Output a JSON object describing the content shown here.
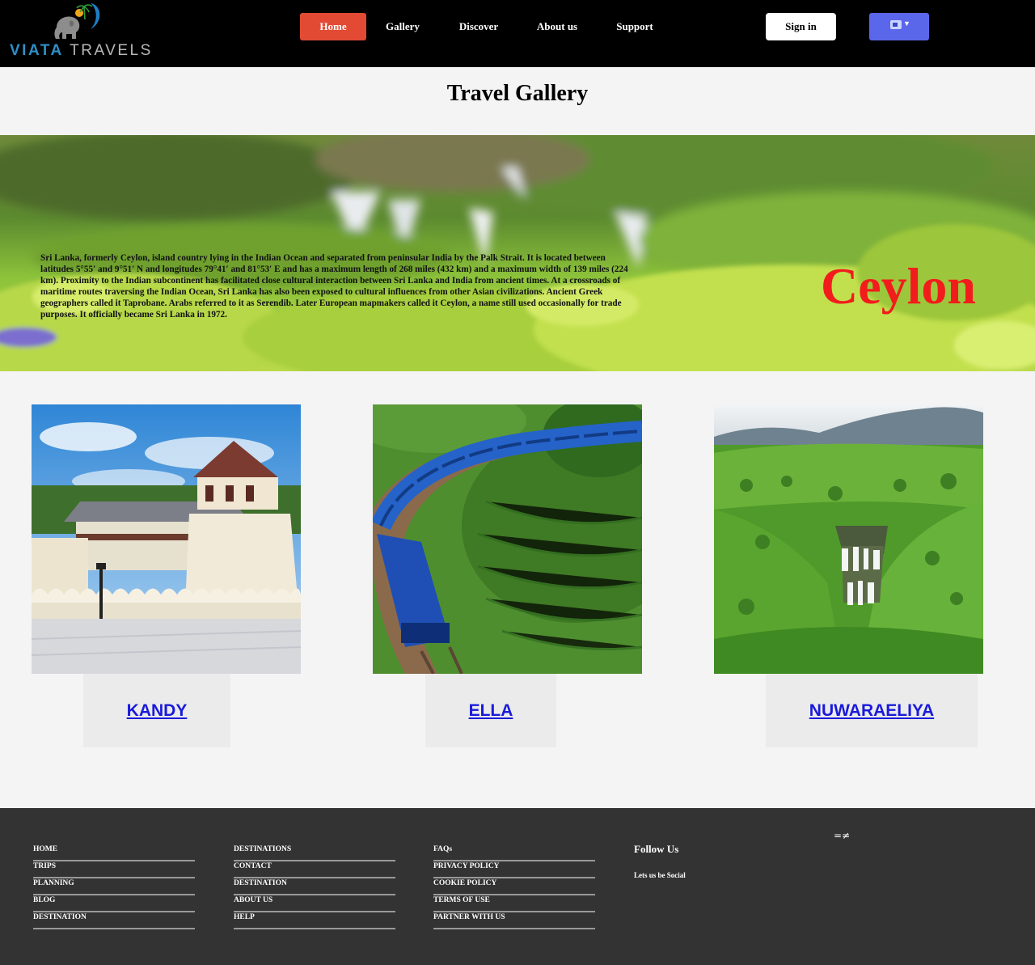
{
  "header": {
    "logo": {
      "word1": "VIATA",
      "word2": "TRAVELS"
    },
    "nav": [
      {
        "label": "Home",
        "active": true
      },
      {
        "label": "Gallery",
        "active": false
      },
      {
        "label": "Discover",
        "active": false
      },
      {
        "label": "About us",
        "active": false
      },
      {
        "label": "Support",
        "active": false
      }
    ],
    "signin_label": "Sign in",
    "language_icon": "translate-icon",
    "accent_color": "#e24a33",
    "language_button_color": "#5b67ea"
  },
  "page": {
    "title": "Travel Gallery"
  },
  "banner": {
    "heading": "Ceylon",
    "heading_color": "#f21c1c",
    "text": "Sri Lanka, formerly Ceylon, island country lying in the Indian Ocean and separated from peninsular India by the Palk Strait. It is located between latitudes 5°55′ and 9°51′ N and longitudes 79°41′ and 81°53′ E and has a maximum length of 268 miles (432 km) and a maximum width of 139 miles (224 km). Proximity to the Indian subcontinent has facilitated close cultural interaction between Sri Lanka and India from ancient times. At a crossroads of maritime routes traversing the Indian Ocean, Sri Lanka has also been exposed to cultural influences from other Asian civilizations. Ancient Greek geographers called it Taprobane. Arabs referred to it as Serendib. Later European mapmakers called it Ceylon, a name still used occasionally for trade purposes. It officially became Sri Lanka in 1972."
  },
  "destinations": [
    {
      "name": "KANDY",
      "image": "temple-image"
    },
    {
      "name": "ELLA",
      "image": "train-image"
    },
    {
      "name": "NUWARAELIYA",
      "image": "waterfall-image"
    }
  ],
  "footer": {
    "columns": [
      [
        "HOME",
        "TRIPS",
        "PLANNING",
        "BLOG",
        "DESTINATION"
      ],
      [
        "DESTINATIONS",
        "CONTACT",
        "DESTINATION",
        "ABOUT US",
        "HELP"
      ],
      [
        "FAQs",
        "PRIVACY POLICY",
        "COOKIE POLICY",
        "TERMS OF USE",
        "PARTNER WITH US"
      ]
    ],
    "follow_title": "Follow Us",
    "follow_subtitle": "Lets us be Social",
    "social_icon_glyph": "=≠",
    "background_color": "#333333"
  }
}
